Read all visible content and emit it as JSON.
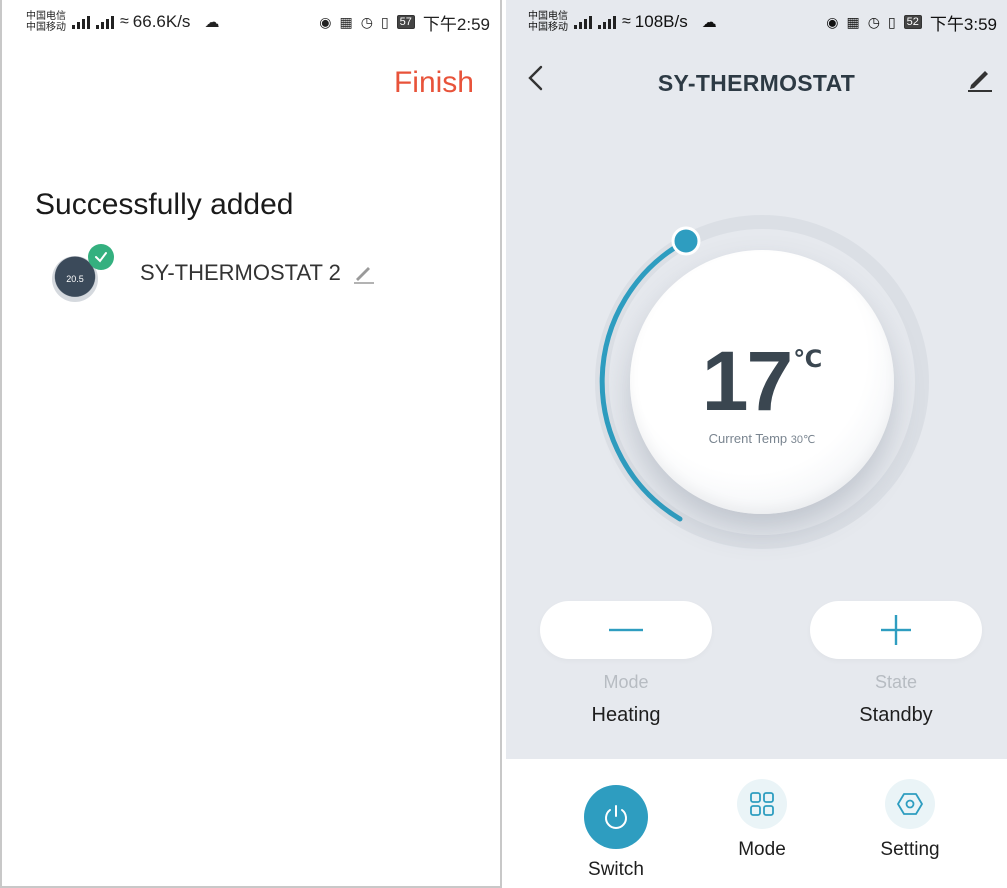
{
  "left_screen": {
    "status_bar": {
      "carrier_1": "中国电信",
      "carrier_2": "中国移动",
      "net_speed": "66.6K/s",
      "battery": "57",
      "time": "下午2:59"
    },
    "finish_label": "Finish",
    "success_title": "Successfully added",
    "device": {
      "name": "SY-THERMOSTAT 2",
      "thumb_text": "20.5"
    }
  },
  "right_screen": {
    "status_bar": {
      "carrier_1": "中国电信",
      "carrier_2": "中国移动",
      "net_speed": "108B/s",
      "battery": "52",
      "time": "下午3:59"
    },
    "title": "SY-THERMOSTAT",
    "dial": {
      "set_temp": "17",
      "unit": "℃",
      "current_label": "Current Temp",
      "current_value": "30℃"
    },
    "mode": {
      "label": "Mode",
      "value": "Heating"
    },
    "state": {
      "label": "State",
      "value": "Standby"
    },
    "nav": [
      {
        "label": "Switch",
        "icon": "power-icon"
      },
      {
        "label": "Mode",
        "icon": "grid-icon"
      },
      {
        "label": "Setting",
        "icon": "hexagon-settings-icon"
      }
    ],
    "colors": {
      "accent": "#2e9dc0",
      "background": "#e6e9ee",
      "finish": "#e8533a",
      "check": "#34b07f"
    }
  }
}
